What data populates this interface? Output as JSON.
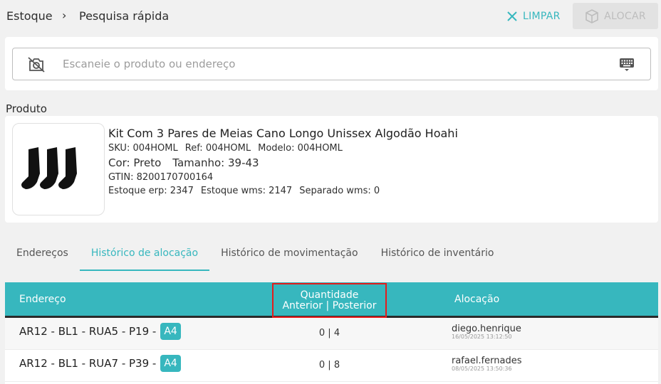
{
  "breadcrumb": {
    "root": "Estoque",
    "separator": "›",
    "current": "Pesquisa rápida"
  },
  "actions": {
    "clear_label": "LIMPAR",
    "allocate_label": "ALOCAR"
  },
  "scan": {
    "placeholder": "Escaneie o produto ou endereço",
    "value": ""
  },
  "product_section": {
    "title": "Produto"
  },
  "product": {
    "name": "Kit Com 3 Pares de Meias Cano Longo Unissex Algodão Hoahi",
    "sku": "SKU: 004HOML",
    "ref": "Ref: 004HOML",
    "model": "Modelo: 004HOML",
    "color": "Cor: Preto",
    "size": "Tamanho: 39-43",
    "gtin": "GTIN: 8200170700164",
    "stock_erp": "Estoque erp: 2347",
    "stock_wms": "Estoque wms: 2147",
    "separated_wms": "Separado wms: 0"
  },
  "tabs": [
    {
      "label": "Endereços",
      "active": false
    },
    {
      "label": "Histórico de alocação",
      "active": true
    },
    {
      "label": "Histórico de movimentação",
      "active": false
    },
    {
      "label": "Histórico de inventário",
      "active": false
    }
  ],
  "table": {
    "headers": {
      "address": "Endereço",
      "quantity_line1": "Quantidade",
      "quantity_line2": "Anterior | Posterior",
      "allocation": "Alocação"
    },
    "rows": [
      {
        "address": "AR12 - BL1 - RUA5 - P19 -",
        "badge": "A4",
        "quantity": "0 | 4",
        "user": "diego.henrique",
        "date": "16/05/2025 13:12:50"
      },
      {
        "address": "AR12 - BL1 - RUA7 - P39 -",
        "badge": "A4",
        "quantity": "0 | 8",
        "user": "rafael.fernades",
        "date": "08/05/2025 13:50:36"
      }
    ]
  },
  "colors": {
    "accent": "#37b7be",
    "highlight": "#e51c1c",
    "disabled_bg": "#e2e2e2"
  },
  "icons": {
    "clear": "close-icon",
    "allocate": "box-icon",
    "camera": "camera-off-icon",
    "keyboard": "keyboard-icon"
  }
}
